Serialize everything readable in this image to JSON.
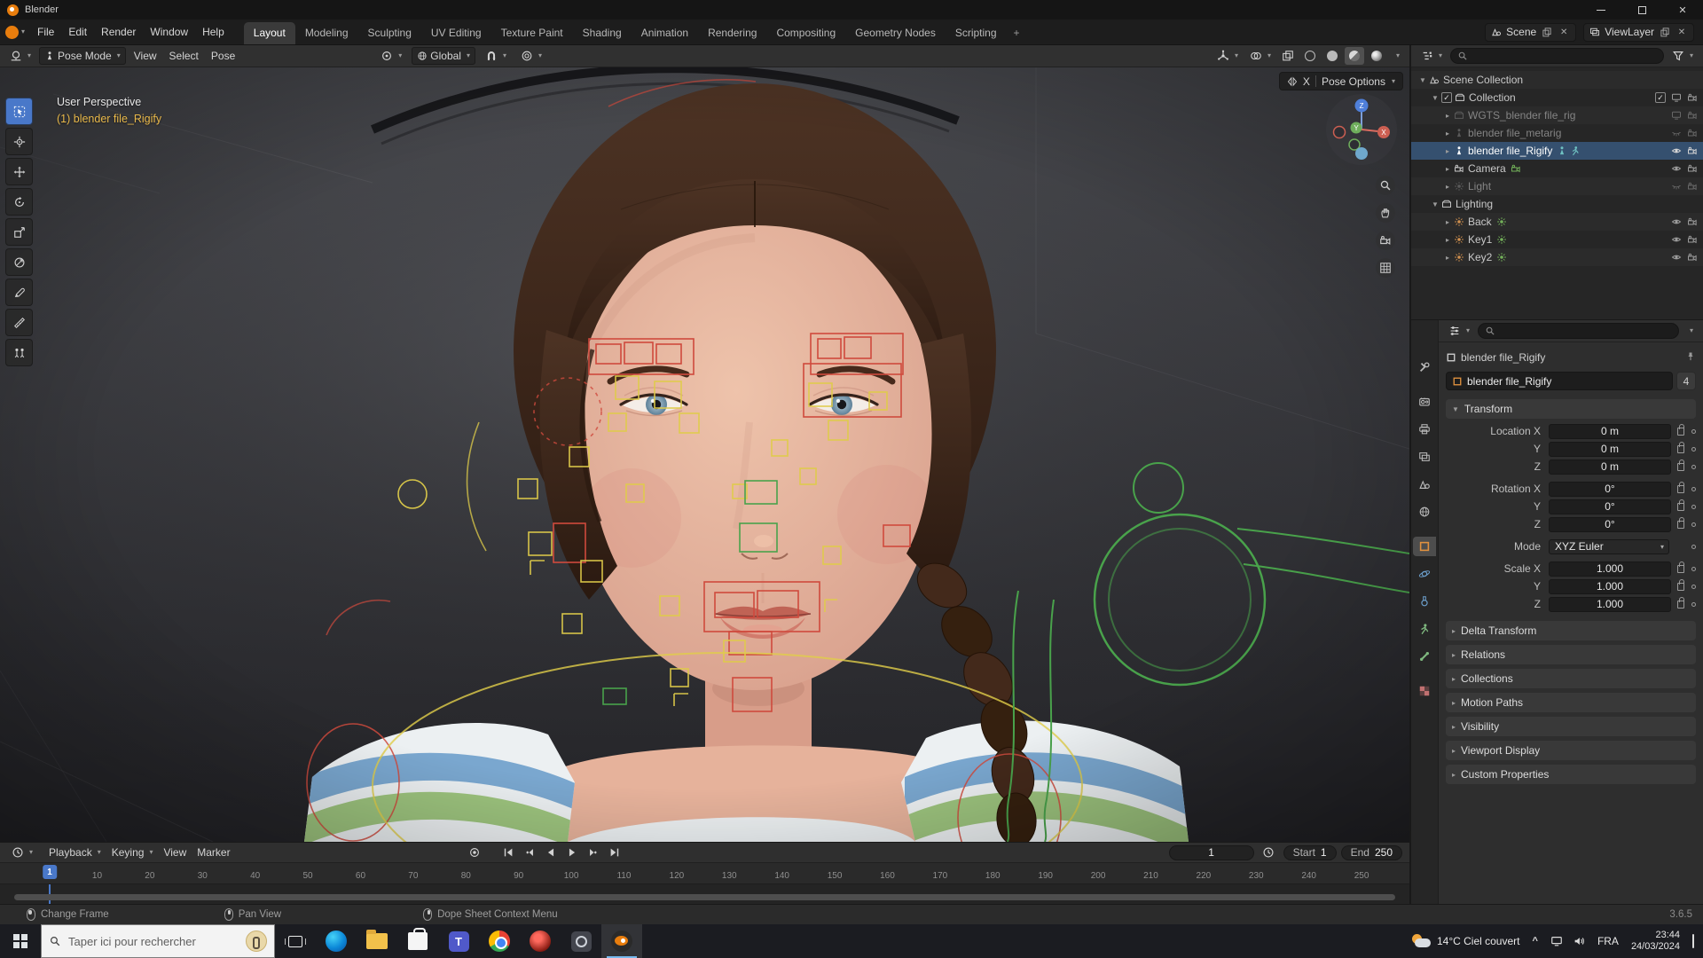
{
  "titlebar": {
    "title": "Blender"
  },
  "topbar": {
    "menus": [
      "File",
      "Edit",
      "Render",
      "Window",
      "Help"
    ],
    "workspaces": [
      "Layout",
      "Modeling",
      "Sculpting",
      "UV Editing",
      "Texture Paint",
      "Shading",
      "Animation",
      "Rendering",
      "Compositing",
      "Geometry Nodes",
      "Scripting"
    ],
    "add_tab": "+",
    "scene_name": "Scene",
    "viewlayer_name": "ViewLayer"
  },
  "viewport": {
    "mode": "Pose Mode",
    "menus": [
      "View",
      "Select",
      "Pose"
    ],
    "orientation": "Global",
    "mirror_x": "X",
    "pose_options": "Pose Options",
    "perspective_label": "User Perspective",
    "active_object": "(1) blender file_Rigify",
    "gizmo": {
      "x": "X",
      "y": "Y",
      "z": "Z"
    },
    "tools": [
      "select-box",
      "cursor",
      "move",
      "rotate",
      "scale",
      "transform",
      "annotate",
      "measure",
      "pose-breakdowner"
    ]
  },
  "outliner": {
    "rows": [
      {
        "label": "Scene Collection"
      },
      {
        "label": "Collection"
      },
      {
        "label": "WGTS_blender file_rig"
      },
      {
        "label": "blender file_metarig"
      },
      {
        "label": "blender file_Rigify"
      },
      {
        "label": "Camera"
      },
      {
        "label": "Light"
      },
      {
        "label": "Lighting"
      },
      {
        "label": "Back"
      },
      {
        "label": "Key1"
      },
      {
        "label": "Key2"
      }
    ]
  },
  "properties": {
    "breadcrumb": "blender file_Rigify",
    "name_value": "blender file_Rigify",
    "users_count": "4",
    "transform_header": "Transform",
    "rows": [
      {
        "label": "Location X",
        "value": "0 m"
      },
      {
        "label": "Y",
        "value": "0 m"
      },
      {
        "label": "Z",
        "value": "0 m"
      },
      {
        "label": "Rotation X",
        "value": "0°"
      },
      {
        "label": "Y",
        "value": "0°"
      },
      {
        "label": "Z",
        "value": "0°"
      },
      {
        "label": "Mode",
        "value": "XYZ Euler"
      },
      {
        "label": "Scale X",
        "value": "1.000"
      },
      {
        "label": "Y",
        "value": "1.000"
      },
      {
        "label": "Z",
        "value": "1.000"
      }
    ],
    "sections": [
      "Delta Transform",
      "Relations",
      "Collections",
      "Motion Paths",
      "Visibility",
      "Viewport Display",
      "Custom Properties"
    ]
  },
  "timeline": {
    "menus": [
      "Playback",
      "Keying",
      "View",
      "Marker"
    ],
    "current_frame": "1",
    "start_label": "Start",
    "start_value": "1",
    "end_label": "End",
    "end_value": "250",
    "ticks": [
      10,
      20,
      30,
      40,
      50,
      60,
      70,
      80,
      90,
      100,
      110,
      120,
      130,
      140,
      150,
      160,
      170,
      180,
      190,
      200,
      210,
      220,
      230,
      240,
      250
    ]
  },
  "statusbar": {
    "items": [
      "Change Frame",
      "Pan View",
      "Dope Sheet Context Menu"
    ],
    "version": "3.6.5"
  },
  "taskbar": {
    "search_placeholder": "Taper ici pour rechercher",
    "weather": "14°C Ciel couvert",
    "language": "FRA",
    "time": "23:44",
    "date": "24/03/2024"
  },
  "colors": {
    "accent": "#4978c9",
    "selection": "#35506f",
    "blender_orange": "#e87d0d",
    "active_object_text": "#e8b84a"
  }
}
